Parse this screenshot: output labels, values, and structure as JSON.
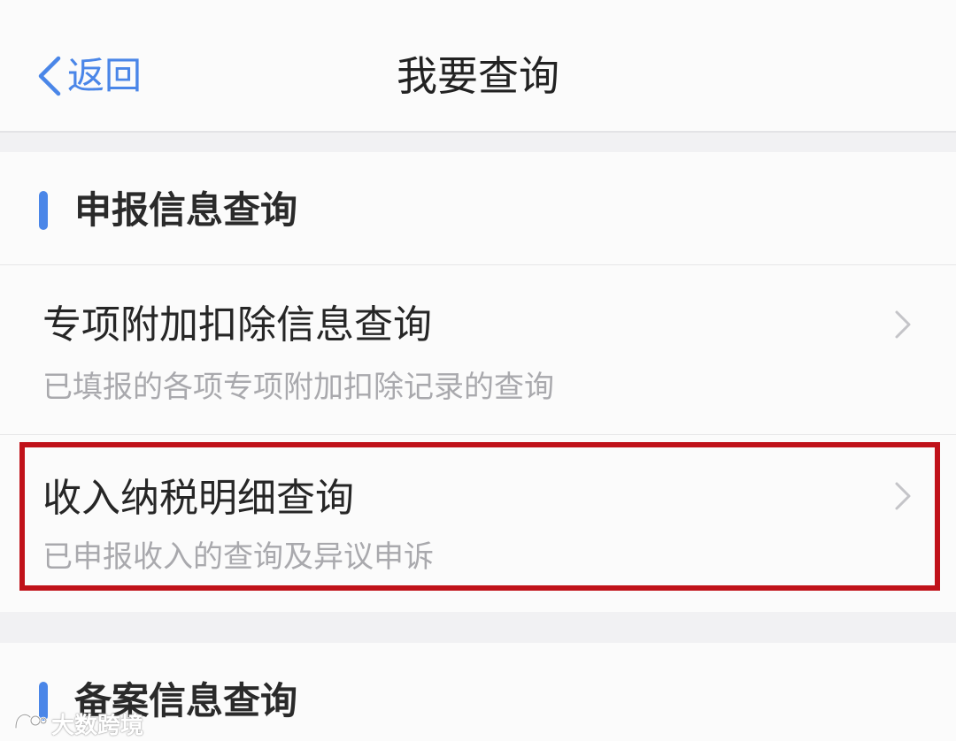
{
  "navbar": {
    "back_label": "返回",
    "title": "我要查询"
  },
  "sections": [
    {
      "title": "申报信息查询",
      "items": [
        {
          "title": "专项附加扣除信息查询",
          "subtitle": "已填报的各项专项附加扣除记录的查询"
        },
        {
          "title": "收入纳税明细查询",
          "subtitle": "已申报收入的查询及异议申诉",
          "highlighted": true
        }
      ]
    },
    {
      "title": "备案信息查询"
    }
  ],
  "colors": {
    "accent": "#4a86e8",
    "highlight_border": "#c0121a",
    "background": "#f1f1f3",
    "card": "#fbfbfb"
  },
  "watermark": {
    "text": "大数跨境"
  }
}
